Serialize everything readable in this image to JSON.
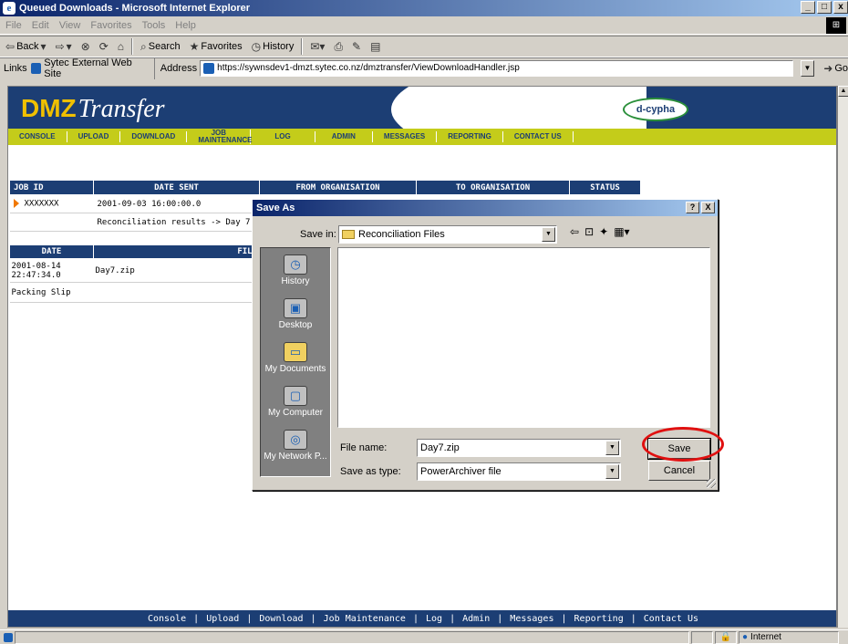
{
  "window": {
    "title": "Queued Downloads - Microsoft Internet Explorer",
    "buttons": [
      "_",
      "□",
      "x"
    ]
  },
  "menu": [
    "File",
    "Edit",
    "View",
    "Favorites",
    "Tools",
    "Help"
  ],
  "toolbar": {
    "back": "Back",
    "search": "Search",
    "favorites": "Favorites",
    "history": "History"
  },
  "addressbar": {
    "links_label": "Links",
    "ext_site": "Sytec External Web Site",
    "address_label": "Address",
    "url": "https://sywnsdev1-dmzt.sytec.co.nz/dmztransfer/ViewDownloadHandler.jsp",
    "go": "Go"
  },
  "page": {
    "logo_dmz": "DMZ",
    "logo_transfer": "Transfer",
    "partner": "d-cypha",
    "nav": [
      "CONSOLE",
      "UPLOAD",
      "DOWNLOAD",
      "JOB MAINTENANCE",
      "LOG",
      "ADMIN",
      "MESSAGES",
      "REPORTING",
      "CONTACT US"
    ],
    "job_table": {
      "headers": [
        "JOB ID",
        "DATE SENT",
        "FROM ORGANISATION",
        "TO ORGANISATION",
        "STATUS"
      ],
      "job_id": "XXXXXXX",
      "date_sent": "2001-09-03 16:00:00.0",
      "description": "Reconciliation results -> Day 7"
    },
    "file_table": {
      "headers": [
        "DATE",
        "FILE"
      ],
      "rows": [
        {
          "date": "2001-08-14 22:47:34.0",
          "file": "Day7.zip"
        },
        {
          "date": "Packing Slip",
          "file": ""
        }
      ]
    },
    "footer": [
      "Console",
      "Upload",
      "Download",
      "Job Maintenance",
      "Log",
      "Admin",
      "Messages",
      "Reporting",
      "Contact Us"
    ]
  },
  "status": {
    "zone": "Internet"
  },
  "dialog": {
    "title": "Save As",
    "help_btn": "?",
    "close_btn": "X",
    "save_in_label": "Save in:",
    "save_in_value": "Reconciliation Files",
    "places": [
      "History",
      "Desktop",
      "My Documents",
      "My Computer",
      "My Network P..."
    ],
    "file_name_label": "File name:",
    "file_name_value": "Day7.zip",
    "save_type_label": "Save as type:",
    "save_type_value": "PowerArchiver file",
    "save_button": "Save",
    "cancel_button": "Cancel"
  }
}
